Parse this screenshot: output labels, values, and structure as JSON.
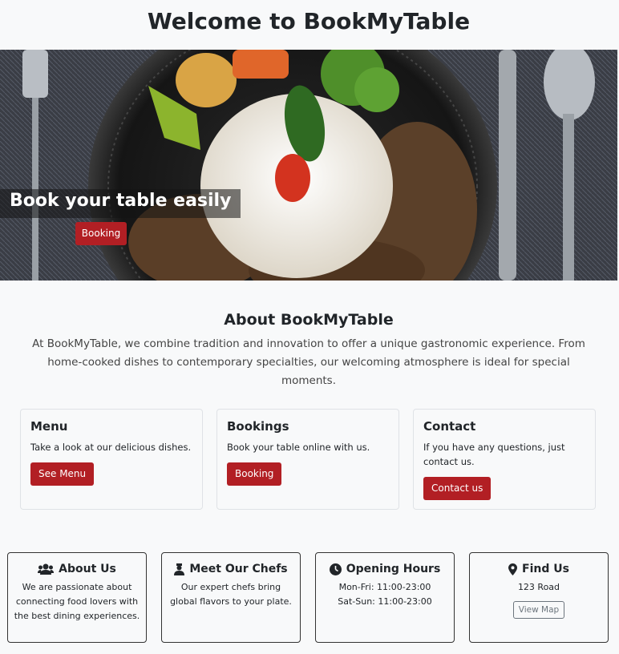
{
  "header": {
    "title": "Welcome to BookMyTable"
  },
  "hero": {
    "heading": "Book your table easily",
    "button_label": "Booking"
  },
  "about": {
    "title": "About BookMyTable",
    "text": "At BookMyTable, we combine tradition and innovation to offer a unique gastronomic experience. From home-cooked dishes to contemporary specialties, our welcoming atmosphere is ideal for special moments."
  },
  "cards": [
    {
      "title": "Menu",
      "text": "Take a look at our delicious dishes.",
      "button_label": "See Menu"
    },
    {
      "title": "Bookings",
      "text": "Book your table online with us.",
      "button_label": "Booking"
    },
    {
      "title": "Contact",
      "text": "If you have any questions, just contact us.",
      "button_label": "Contact us"
    }
  ],
  "info": [
    {
      "icon": "users-icon",
      "title": "About Us",
      "text": "We are passionate about connecting food lovers with the best dining experiences."
    },
    {
      "icon": "chef-icon",
      "title": "Meet Our Chefs",
      "text": "Our expert chefs bring global flavors to your plate."
    },
    {
      "icon": "clock-icon",
      "title": "Opening Hours",
      "line1": "Mon-Fri: 11:00-23:00",
      "line2": "Sat-Sun: 11:00-23:00"
    },
    {
      "icon": "map-pin-icon",
      "title": "Find Us",
      "text": "123 Road",
      "button_label": "View Map"
    }
  ],
  "colors": {
    "accent": "#b21f24",
    "background": "#f8f9fa",
    "text": "#212529"
  }
}
